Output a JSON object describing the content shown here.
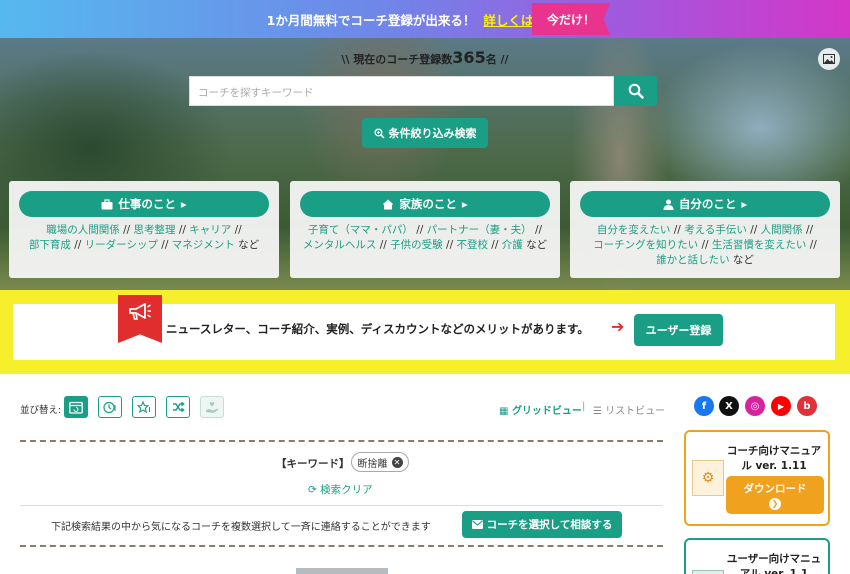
{
  "banner": {
    "text": "1か月間無料でコーチ登録が出来る！",
    "link": "詳しくはクリック",
    "tag": "今だけ！"
  },
  "hero": {
    "count_prefix": "\\\\ 現在のコーチ登録数",
    "count_number": "365",
    "count_suffix": "名 //",
    "image_icon": "image-icon",
    "search_placeholder": "コーチを探すキーワード",
    "search_icon": "search-icon",
    "filter_label": "条件絞り込み検索"
  },
  "categories": [
    {
      "title": "仕事のこと",
      "icon": "briefcase-icon",
      "links": [
        "職場の人間関係",
        "思考整理",
        "キャリア",
        "部下育成",
        "リーダーシップ",
        "マネジメント"
      ],
      "tail": "など"
    },
    {
      "title": "家族のこと",
      "icon": "house-icon",
      "links": [
        "子育て（ママ・パパ）",
        "パートナー（妻・夫）",
        "メンタルヘルス",
        "子供の受験",
        "不登校",
        "介護"
      ],
      "tail": "など"
    },
    {
      "title": "自分のこと",
      "icon": "person-icon",
      "links": [
        "自分を変えたい",
        "考える手伝い",
        "人間関係",
        "コーチングを知りたい",
        "生活習慣を変えたい",
        "誰かと話したい"
      ],
      "tail": "など"
    }
  ],
  "promo": {
    "text": "ニュースレター、コーチ紹介、実例、ディスカウントなどのメリットがあります。",
    "button": "ユーザー登録",
    "icon": "megaphone-icon"
  },
  "sort": {
    "label": "並び替え:",
    "view_grid": "グリッドビュー",
    "view_separator": "|",
    "view_list": "リストビュー"
  },
  "search_state": {
    "keyword_label": "【キーワード】",
    "keyword_value": "断捨離",
    "clear_label": "検索クリア",
    "bulk_text": "下記検索結果の中から気になるコーチを複数選択して一斉に連絡することができます",
    "bulk_button": "コーチを選択して相談する"
  },
  "sidebar": {
    "social": [
      {
        "name": "facebook",
        "glyph": "f",
        "color": "#1877f2"
      },
      {
        "name": "x",
        "glyph": "X",
        "color": "#111111"
      },
      {
        "name": "instagram",
        "glyph": "◎",
        "color": "#d6249f"
      },
      {
        "name": "youtube",
        "glyph": "▶",
        "color": "#ff0000"
      },
      {
        "name": "blog",
        "glyph": "b",
        "color": "#e0303a"
      }
    ],
    "manual1_title": "コーチ向けマニュアル ver. 1.11",
    "manual1_button": "ダウンロード",
    "manual2_title": "ユーザー向けマニュアル ver. 1.1"
  },
  "colors": {
    "accent": "#1a9e86",
    "promo_yellow": "#f5ef2c",
    "ribbon_red": "#e02e2e",
    "manual_orange": "#f0a21e"
  }
}
